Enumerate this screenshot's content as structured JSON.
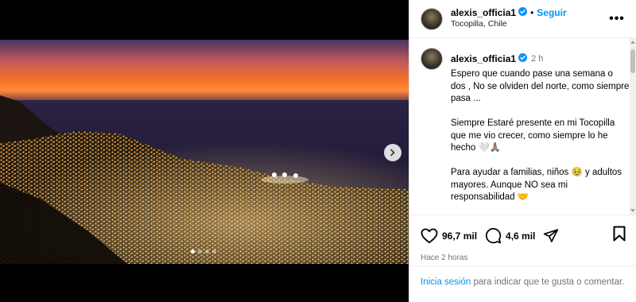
{
  "post": {
    "username": "alexis_officia1",
    "follow_label": "Seguir",
    "separator": "•",
    "location": "Tocopilla, Chile",
    "more_label": "•••",
    "time_short": "2 h",
    "caption": "Espero que cuando pase una semana o dos , No se olviden del norte, como siempre pasa ...\n\nSiempre Estaré presente en mi Tocopilla que me vio crecer, como siempre lo he hecho 🤍🙏🏽\n\nPara ayudar a familias, niños 🥹 y adultos mayores. Aunque NO sea mi responsabilidad 🤝\n\nMI TOCOPILLA, NUNCA ESTARÁN",
    "likes": "96,7 mil",
    "comments": "4,6 mil",
    "time_ago": "Hace 2 horas"
  },
  "carousel": {
    "total": 4,
    "active": 0
  },
  "login": {
    "link_label": "Inicia sesión",
    "rest": " para indicar que te gusta o comentar."
  },
  "colors": {
    "accent": "#0095f6",
    "verified": "#0095f6"
  }
}
